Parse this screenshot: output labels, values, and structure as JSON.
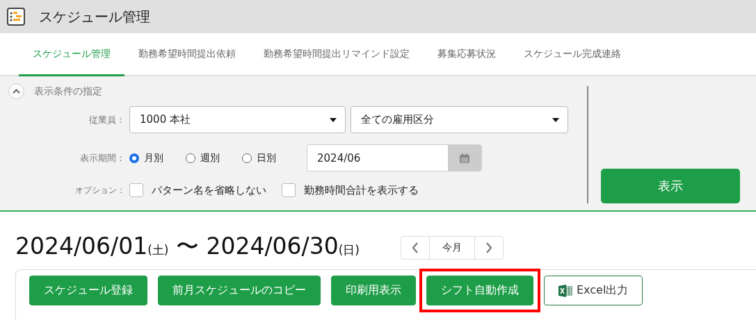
{
  "app": {
    "title": "スケジュール管理"
  },
  "tabs": [
    {
      "label": "スケジュール管理",
      "selected": true
    },
    {
      "label": "勤務希望時間提出依頼",
      "selected": false
    },
    {
      "label": "勤務希望時間提出リマインド設定",
      "selected": false
    },
    {
      "label": "募集応募状況",
      "selected": false
    },
    {
      "label": "スケジュール完成連絡",
      "selected": false
    }
  ],
  "filter": {
    "heading": "表示条件の指定",
    "expanded": true,
    "employee": {
      "label": "従業員：",
      "selects": [
        "1000 本社",
        "全ての雇用区分"
      ]
    },
    "period": {
      "label": "表示期間：",
      "options": [
        {
          "label": "月別",
          "selected": true
        },
        {
          "label": "週別",
          "selected": false
        },
        {
          "label": "日別",
          "selected": false
        }
      ],
      "date": "2024/06"
    },
    "options": {
      "label": "オプション：",
      "items": [
        {
          "label": "パターン名を省略しない",
          "checked": false
        },
        {
          "label": "勤務時間合計を表示する",
          "checked": false
        }
      ]
    },
    "submit": "表示"
  },
  "range": {
    "start": "2024/06/01",
    "start_day": "(土)",
    "separator": "〜",
    "end": "2024/06/30",
    "end_day": "(日)"
  },
  "nav": {
    "today": "今月"
  },
  "actions": [
    {
      "label": "スケジュール登録",
      "kind": "primary",
      "highlighted": false
    },
    {
      "label": "前月スケジュールのコピー",
      "kind": "primary",
      "highlighted": false
    },
    {
      "label": "印刷用表示",
      "kind": "primary",
      "highlighted": false
    },
    {
      "label": "シフト自動作成",
      "kind": "primary",
      "highlighted": true
    },
    {
      "label": "Excel出力",
      "kind": "excel",
      "highlighted": false
    }
  ]
}
